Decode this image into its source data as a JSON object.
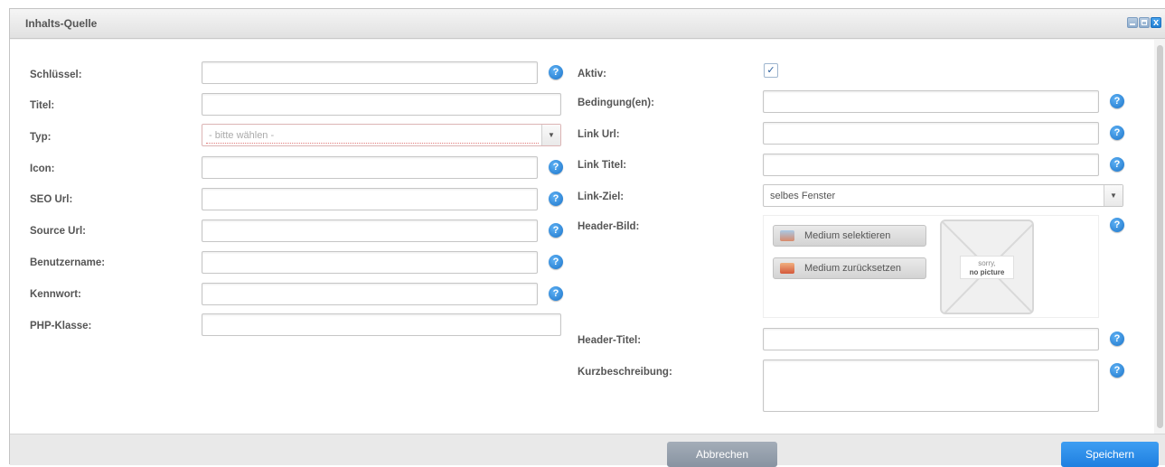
{
  "window": {
    "title": "Inhalts-Quelle",
    "controls": {
      "minimize": "minimize",
      "maximize": "maximize",
      "close": "x"
    }
  },
  "left_form": {
    "fields": [
      {
        "label": "Schlüssel:",
        "value": "",
        "help": "?"
      },
      {
        "label": "Titel:",
        "value": ""
      },
      {
        "label": "Typ:",
        "selected": "- bitte wählen -"
      },
      {
        "label": "Icon:",
        "value": "",
        "help": "?"
      },
      {
        "label": "SEO Url:",
        "value": "",
        "help": "?"
      },
      {
        "label": "Source Url:",
        "value": "",
        "help": "?"
      },
      {
        "label": "Benutzername:",
        "value": "",
        "help": "?"
      },
      {
        "label": "Kennwort:",
        "value": "",
        "help": "?"
      },
      {
        "label": "PHP-Klasse:",
        "value": ""
      }
    ]
  },
  "right_form": {
    "aktiv": {
      "label": "Aktiv:",
      "checked": true,
      "mark": "✓"
    },
    "bedingungen": {
      "label": "Bedingung(en):",
      "value": "",
      "help": "?"
    },
    "link_url": {
      "label": "Link Url:",
      "value": "",
      "help": "?"
    },
    "link_titel": {
      "label": "Link Titel:",
      "value": "",
      "help": "?"
    },
    "link_ziel": {
      "label": "Link-Ziel:",
      "selected": "selbes Fenster"
    },
    "header_bild": {
      "label": "Header-Bild:",
      "help": "?",
      "select_button": "Medium selektieren",
      "reset_button": "Medium zurücksetzen",
      "placeholder_line1": "sorry,",
      "placeholder_line2": "no picture"
    },
    "header_titel": {
      "label": "Header-Titel:",
      "value": "",
      "help": "?"
    },
    "kurzbeschreibung": {
      "label": "Kurzbeschreibung:",
      "value": "",
      "help": "?"
    }
  },
  "footer": {
    "cancel_label": "Abbrechen",
    "save_label": "Speichern"
  }
}
